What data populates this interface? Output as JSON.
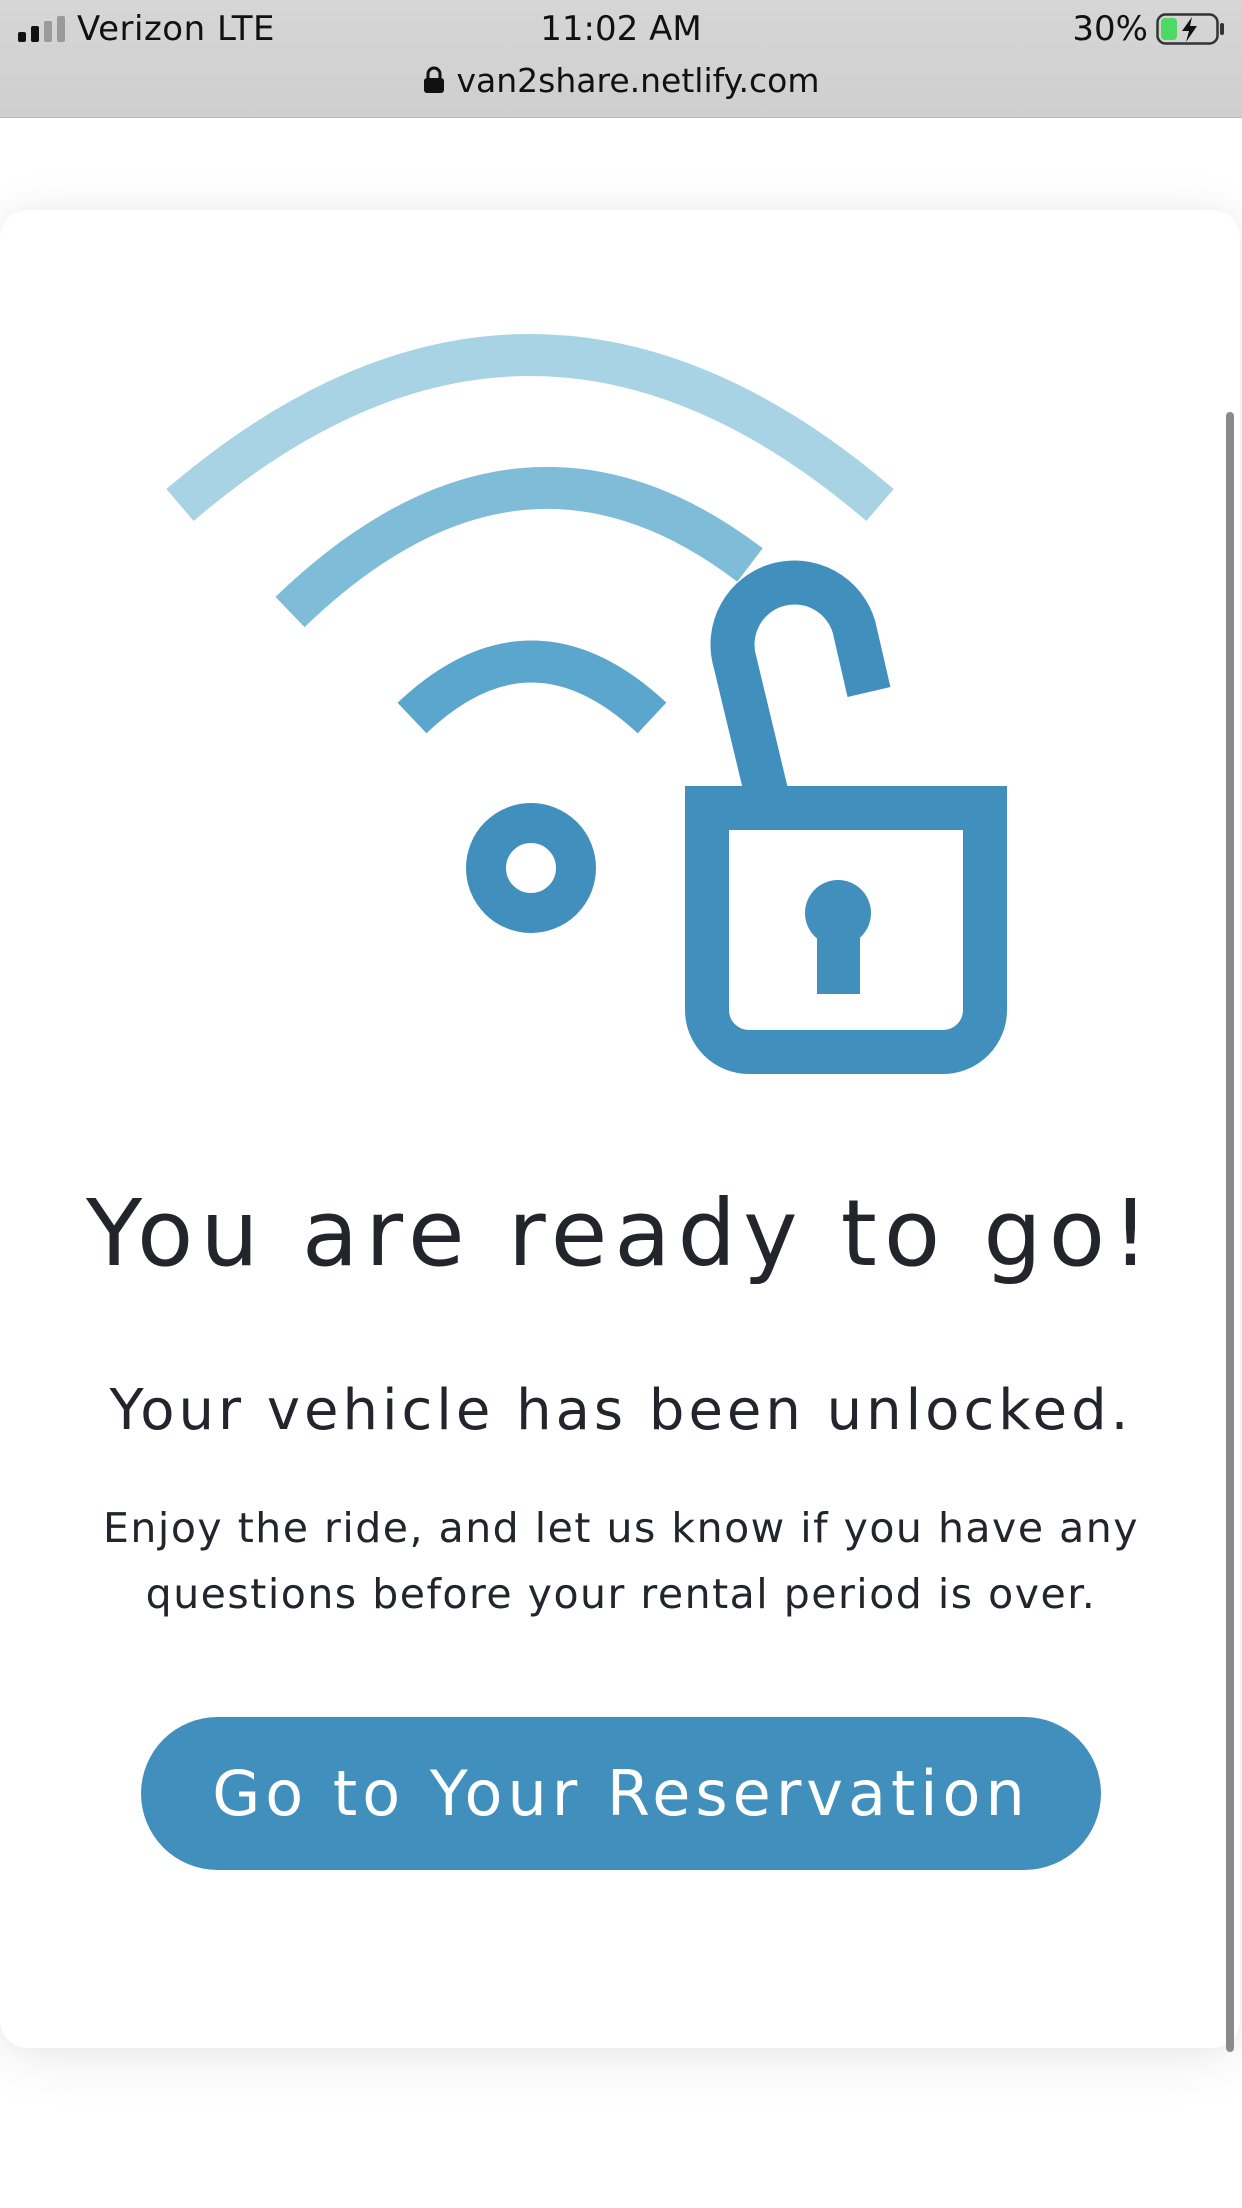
{
  "status_bar": {
    "carrier": "Verizon LTE",
    "time": "11:02 AM",
    "battery_percent": "30%",
    "battery_level": 0.3,
    "signal_bars_active": 2,
    "signal_bars_total": 4,
    "url": "van2share.netlify.com"
  },
  "main": {
    "headline": "You are ready to go!",
    "subheadline": "Your vehicle has been unlocked.",
    "body": "Enjoy the ride, and let us know if you have any questions before your rental period is over.",
    "cta_label": "Go to Your Reservation"
  },
  "colors": {
    "accent": "#418fbd",
    "wave_light": "#a8d3e4",
    "wave_mid": "#7fbcd7",
    "wave_dark": "#5aa6cc",
    "text": "#22252b",
    "battery_green": "#4cd964"
  },
  "icons": {
    "lock": "lock-icon",
    "signal": "cellular-signal-icon",
    "battery": "battery-charging-icon",
    "illustration": "wireless-unlock-icon"
  }
}
